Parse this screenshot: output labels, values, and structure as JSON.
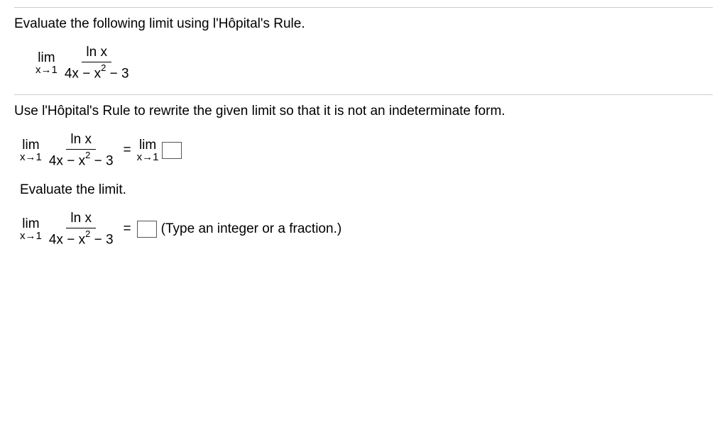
{
  "question": {
    "prompt": "Evaluate the following limit using l'Hôpital's Rule."
  },
  "limit": {
    "lim_text": "lim",
    "approach": "x→1",
    "numerator": "ln x",
    "denominator_prefix": "4x − x",
    "denominator_exp": "2",
    "denominator_suffix": " − 3"
  },
  "instruction1": "Use l'Hôpital's Rule to rewrite the given limit so that it is not an indeterminate form.",
  "equals": "=",
  "instruction2": "Evaluate the limit.",
  "hint": "(Type an integer or a fraction.)"
}
